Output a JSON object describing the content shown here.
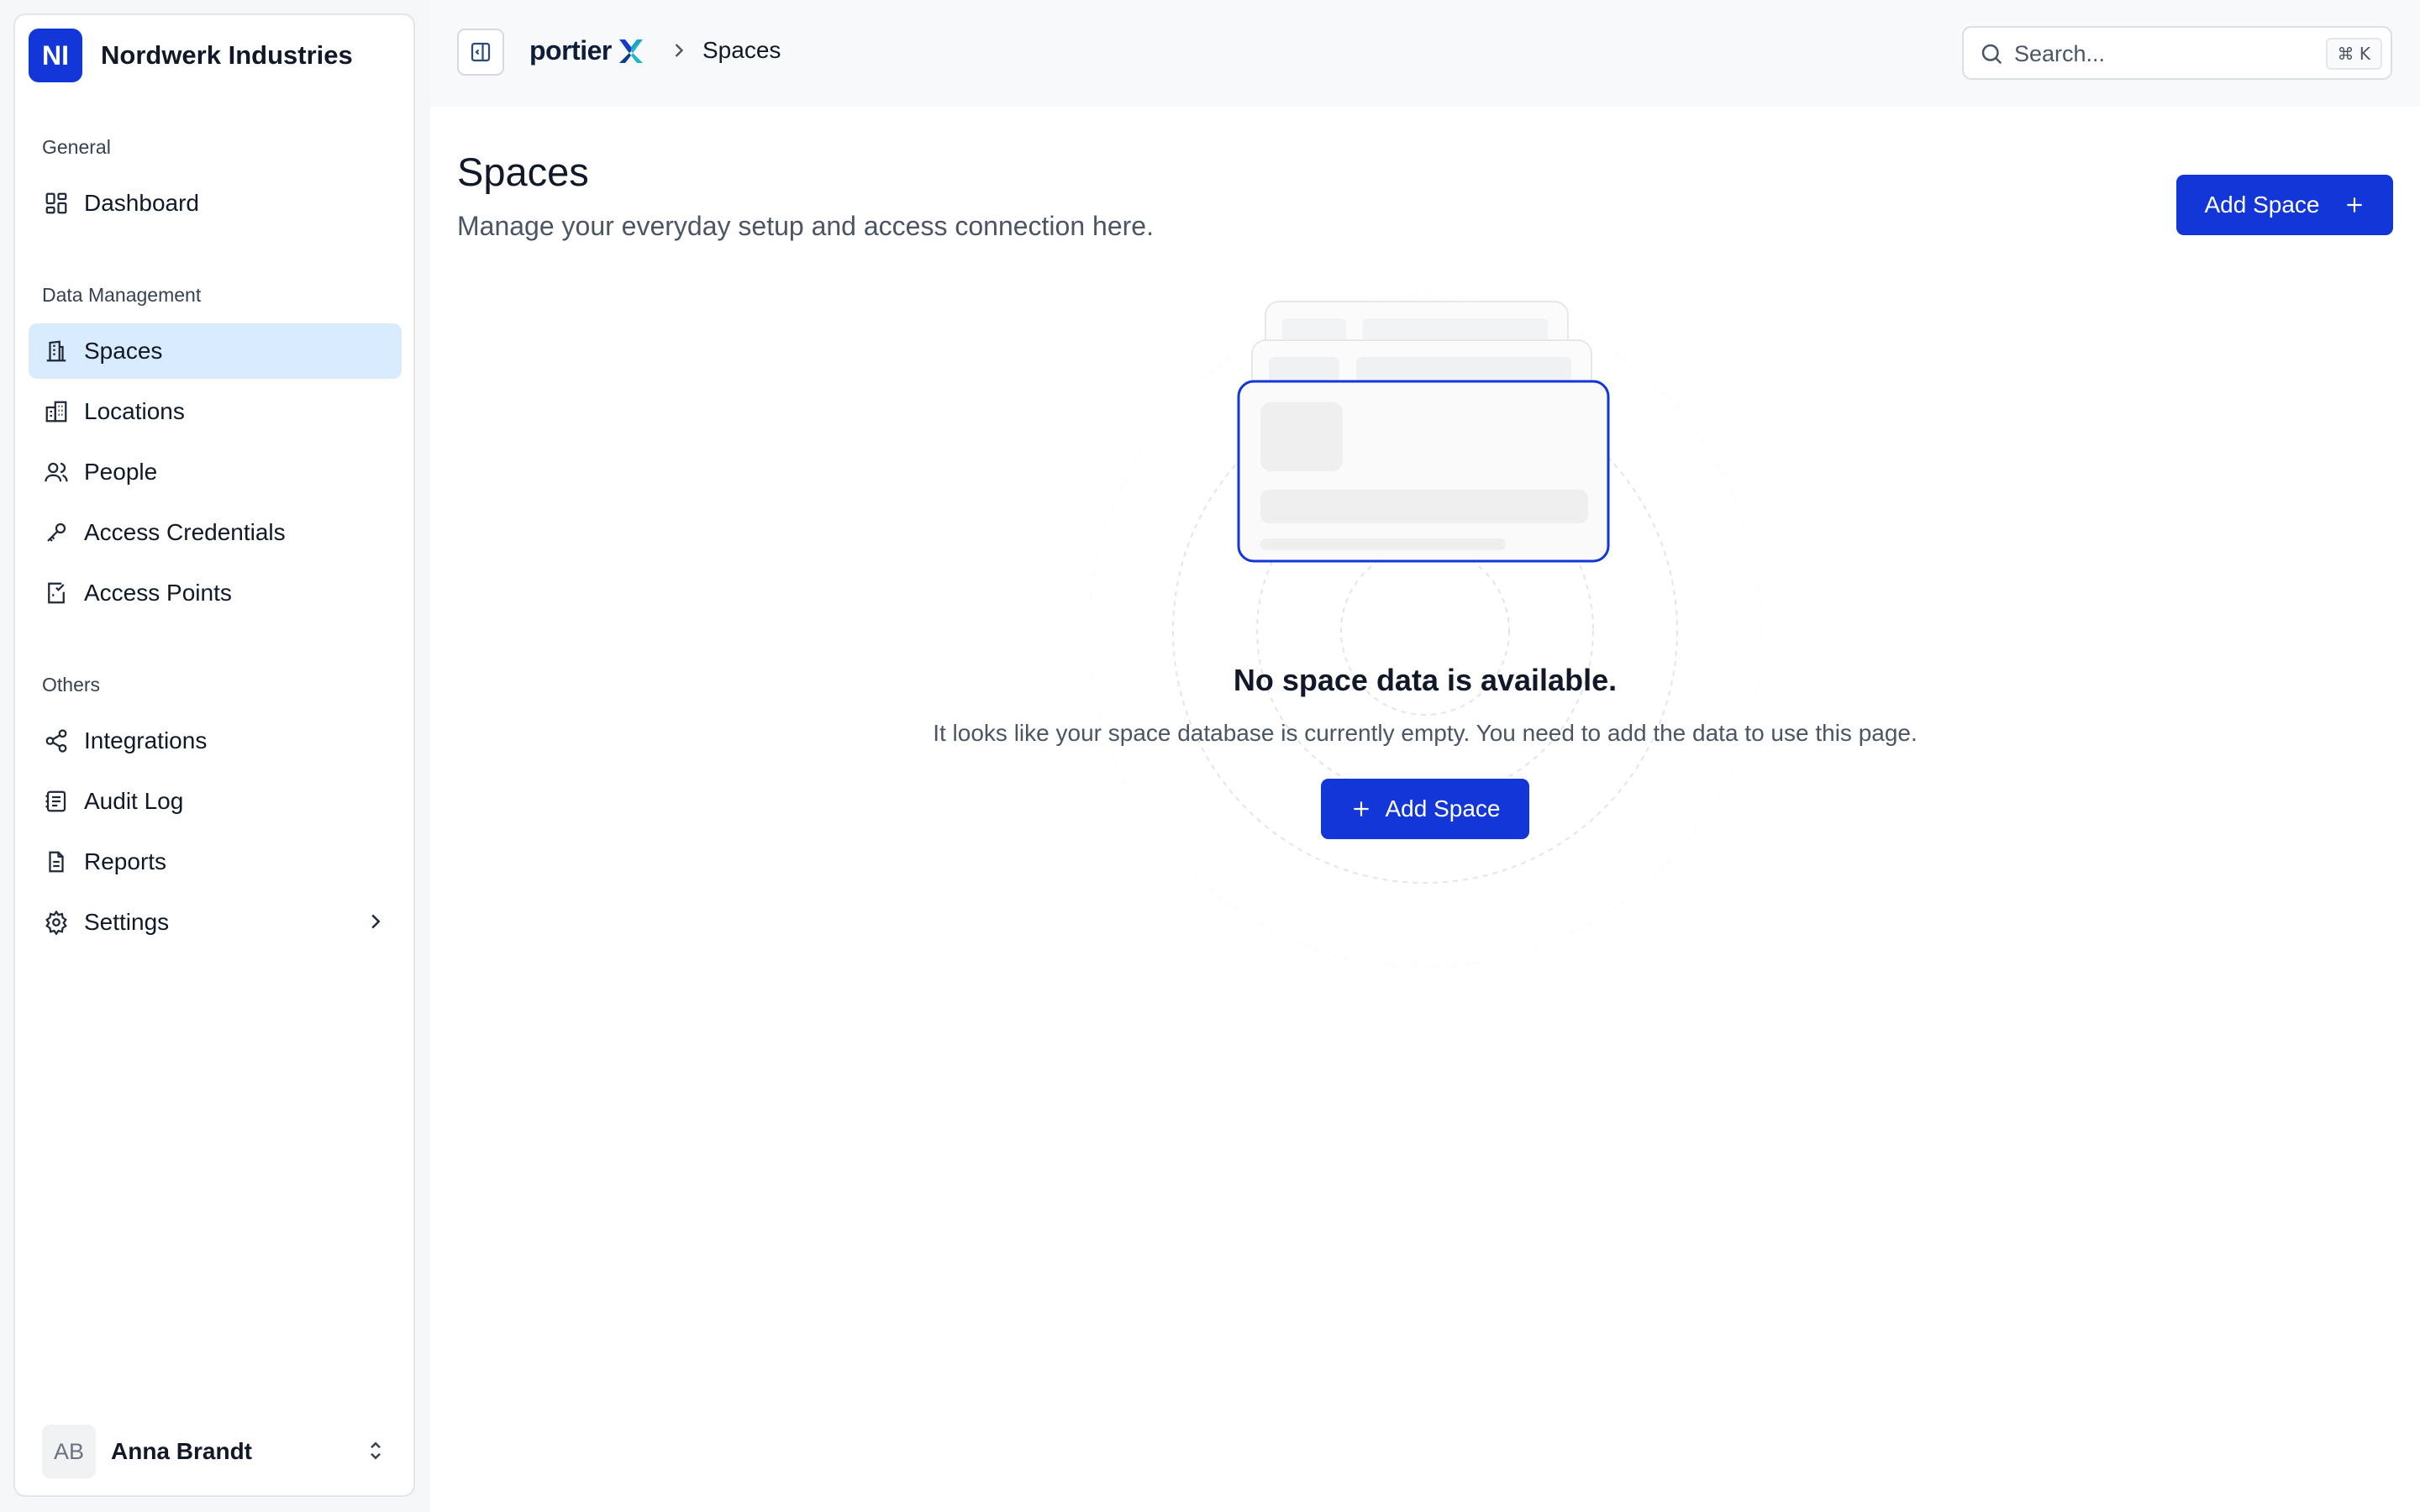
{
  "org": {
    "initials": "NI",
    "name": "Nordwerk Industries"
  },
  "sidebar": {
    "sections": [
      {
        "label": "General",
        "items": [
          {
            "label": "Dashboard",
            "icon": "dashboard-icon"
          }
        ]
      },
      {
        "label": "Data Management",
        "items": [
          {
            "label": "Spaces",
            "icon": "building-icon",
            "active": true
          },
          {
            "label": "Locations",
            "icon": "city-icon"
          },
          {
            "label": "People",
            "icon": "users-icon"
          },
          {
            "label": "Access Credentials",
            "icon": "key-icon"
          },
          {
            "label": "Access Points",
            "icon": "door-check-icon"
          }
        ]
      },
      {
        "label": "Others",
        "items": [
          {
            "label": "Integrations",
            "icon": "share-icon"
          },
          {
            "label": "Audit Log",
            "icon": "log-icon"
          },
          {
            "label": "Reports",
            "icon": "report-icon"
          },
          {
            "label": "Settings",
            "icon": "gear-icon"
          }
        ]
      }
    ]
  },
  "user": {
    "initials": "AB",
    "name": "Anna Brandt"
  },
  "topbar": {
    "brand": "portier",
    "breadcrumb_current": "Spaces",
    "search_placeholder": "Search...",
    "shortcut": "⌘ K"
  },
  "page": {
    "title": "Spaces",
    "subtitle": "Manage your everyday setup and access connection here.",
    "add_button": "Add Space"
  },
  "empty_state": {
    "title": "No space data is available.",
    "text": "It looks like your space database is currently empty. You need to add the data to use this page.",
    "button": "Add Space"
  },
  "colors": {
    "primary": "#1336d9",
    "active_nav": "#d9ebff",
    "brand_accent": "#1fb6c8"
  }
}
